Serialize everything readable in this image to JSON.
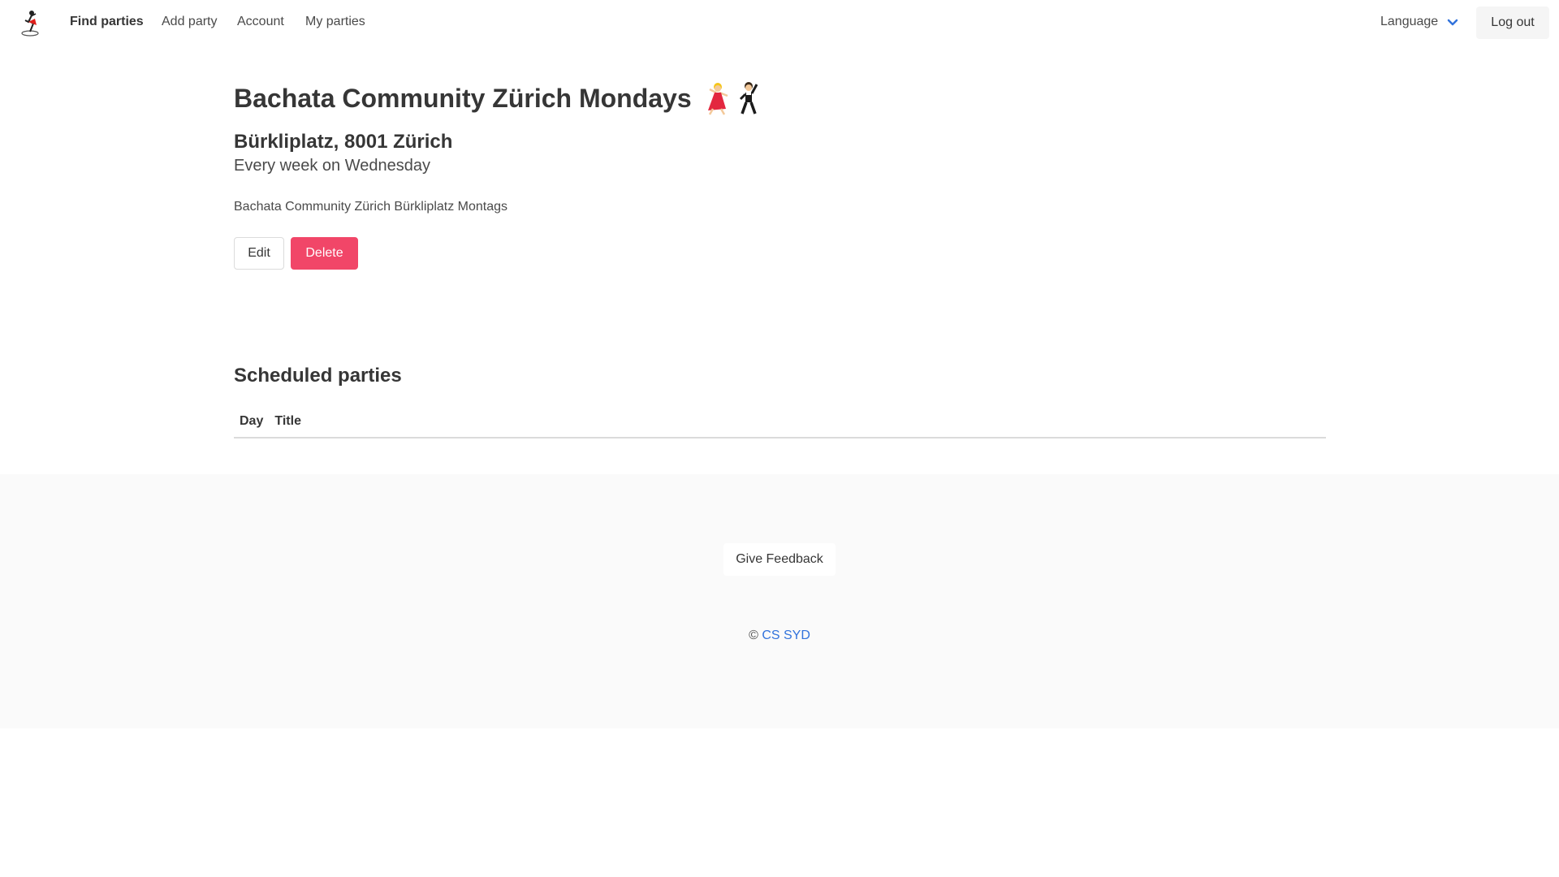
{
  "nav": {
    "logo_icon": "dancer-logo-icon",
    "links": {
      "find": "Find parties",
      "add": "Add party",
      "account": "Account",
      "mine": "My parties"
    },
    "language": "Language",
    "logout": "Log out"
  },
  "party": {
    "title": "Bachata Community Zürich Mondays",
    "title_emoji": [
      "woman-dancing-icon",
      "man-dancing-icon"
    ],
    "address": "Bürkliplatz, 8001 Zürich",
    "schedule": "Every week on Wednesday",
    "description": "Bachata Community Zürich Bürkliplatz Montags",
    "edit_label": "Edit",
    "delete_label": "Delete"
  },
  "scheduled": {
    "heading": "Scheduled parties",
    "columns": [
      "Day",
      "Title"
    ],
    "rows": []
  },
  "footer": {
    "feedback": "Give Feedback",
    "copyright_symbol": "©",
    "copyright_link": "CS SYD"
  },
  "colors": {
    "danger": "#f14668",
    "link": "#3273dc",
    "footer_bg": "#fafafa"
  }
}
